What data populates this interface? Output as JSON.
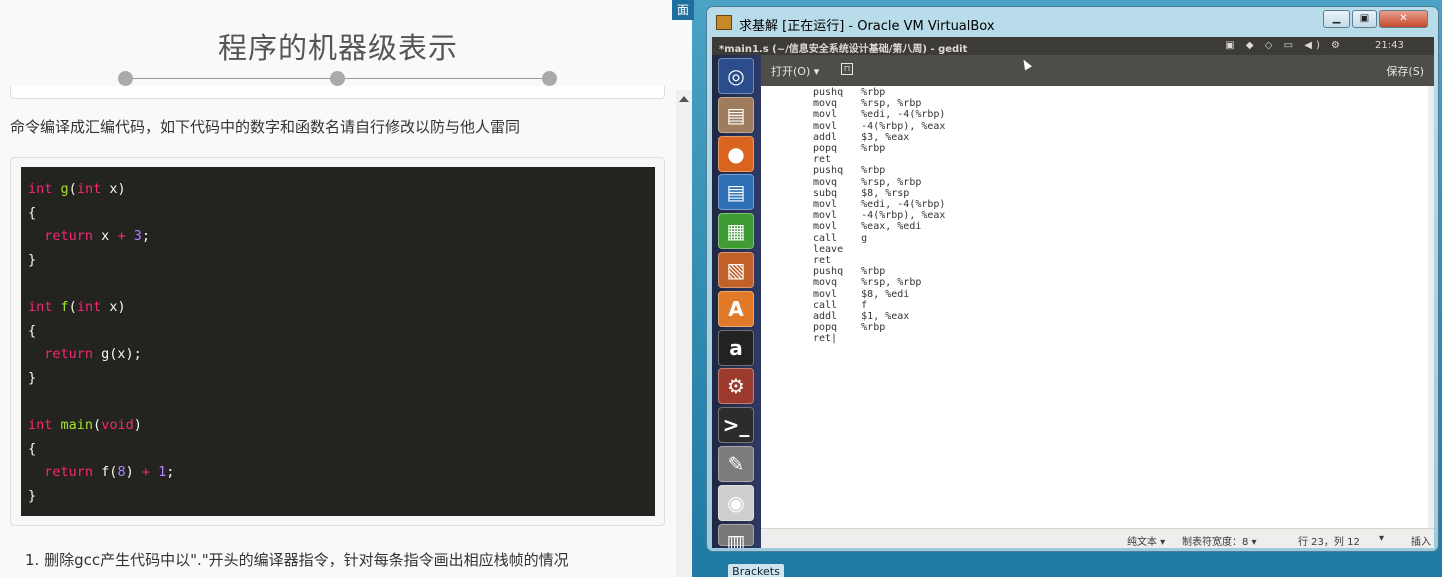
{
  "left": {
    "title": "程序的机器级表示",
    "intro": "命令编译成汇编代码，如下代码中的数字和函数名请自行修改以防与他人雷同",
    "question1": "1. 删除gcc产生代码中以\".\"开头的编译器指令，针对每条指令画出相应栈帧的情况",
    "code_lines": [
      [
        [
          "kw",
          "int"
        ],
        [
          "p",
          " "
        ],
        [
          "fn",
          "g"
        ],
        [
          "p",
          "("
        ],
        [
          "kw",
          "int"
        ],
        [
          "p",
          " x)"
        ]
      ],
      [
        [
          "p",
          "{"
        ]
      ],
      [
        [
          "p",
          "  "
        ],
        [
          "kw",
          "return"
        ],
        [
          "p",
          " x "
        ],
        [
          "kw",
          "+"
        ],
        [
          "p",
          " "
        ],
        [
          "num",
          "3"
        ],
        [
          "p",
          ";"
        ]
      ],
      [
        [
          "p",
          "}"
        ]
      ],
      [
        [
          "p",
          ""
        ]
      ],
      [
        [
          "kw",
          "int"
        ],
        [
          "p",
          " "
        ],
        [
          "fn",
          "f"
        ],
        [
          "p",
          "("
        ],
        [
          "kw",
          "int"
        ],
        [
          "p",
          " x)"
        ]
      ],
      [
        [
          "p",
          "{"
        ]
      ],
      [
        [
          "p",
          "  "
        ],
        [
          "kw",
          "return"
        ],
        [
          "p",
          " g(x);"
        ]
      ],
      [
        [
          "p",
          "}"
        ]
      ],
      [
        [
          "p",
          ""
        ]
      ],
      [
        [
          "kw",
          "int"
        ],
        [
          "p",
          " "
        ],
        [
          "fn",
          "main"
        ],
        [
          "p",
          "("
        ],
        [
          "kw",
          "void"
        ],
        [
          "p",
          ")"
        ]
      ],
      [
        [
          "p",
          "{"
        ]
      ],
      [
        [
          "p",
          "  "
        ],
        [
          "kw",
          "return"
        ],
        [
          "p",
          " f("
        ],
        [
          "num",
          "8"
        ],
        [
          "p",
          ") "
        ],
        [
          "kw",
          "+"
        ],
        [
          "p",
          " "
        ],
        [
          "num",
          "1"
        ],
        [
          "p",
          ";"
        ]
      ],
      [
        [
          "p",
          "}"
        ]
      ]
    ]
  },
  "desktop": {
    "mian": "面",
    "brackets": "Brackets"
  },
  "vbox": {
    "title": "求基解 [正在运行] - Oracle VM VirtualBox",
    "min": "▁",
    "max": "▣",
    "close": "✕"
  },
  "gedit": {
    "window_title": "*main1.s (~/信息安全系统设计基础/第八周) - gedit",
    "clock": "21:43",
    "indicators": "▣ ◆ ◇ ▭ ◀) ⚙",
    "open_label": "打开(O) ▾",
    "save_label": "保存(S)",
    "asm_lines": [
      "pushq   %rbp",
      "movq    %rsp, %rbp",
      "movl    %edi, -4(%rbp)",
      "movl    -4(%rbp), %eax",
      "addl    $3, %eax",
      "popq    %rbp",
      "ret",
      "pushq   %rbp",
      "movq    %rsp, %rbp",
      "subq    $8, %rsp",
      "movl    %edi, -4(%rbp)",
      "movl    -4(%rbp), %eax",
      "movl    %eax, %edi",
      "call    g",
      "leave",
      "ret",
      "pushq   %rbp",
      "movq    %rsp, %rbp",
      "movl    $8, %edi",
      "call    f",
      "addl    $1, %eax",
      "popq    %rbp",
      "ret|"
    ],
    "status": {
      "lang": "纯文本 ▾",
      "tab": "制表符宽度：8 ▾",
      "pos": "行 23，列 12",
      "arrow": "▾",
      "mode": "插入"
    }
  },
  "launcher_icons": [
    "ubuntu-dash-icon",
    "files-icon",
    "firefox-icon",
    "writer-icon",
    "calc-icon",
    "impress-icon",
    "software-center-icon",
    "amazon-icon",
    "settings-icon",
    "terminal-icon",
    "text-editor-icon",
    "dvd-icon",
    "trash-icon"
  ]
}
